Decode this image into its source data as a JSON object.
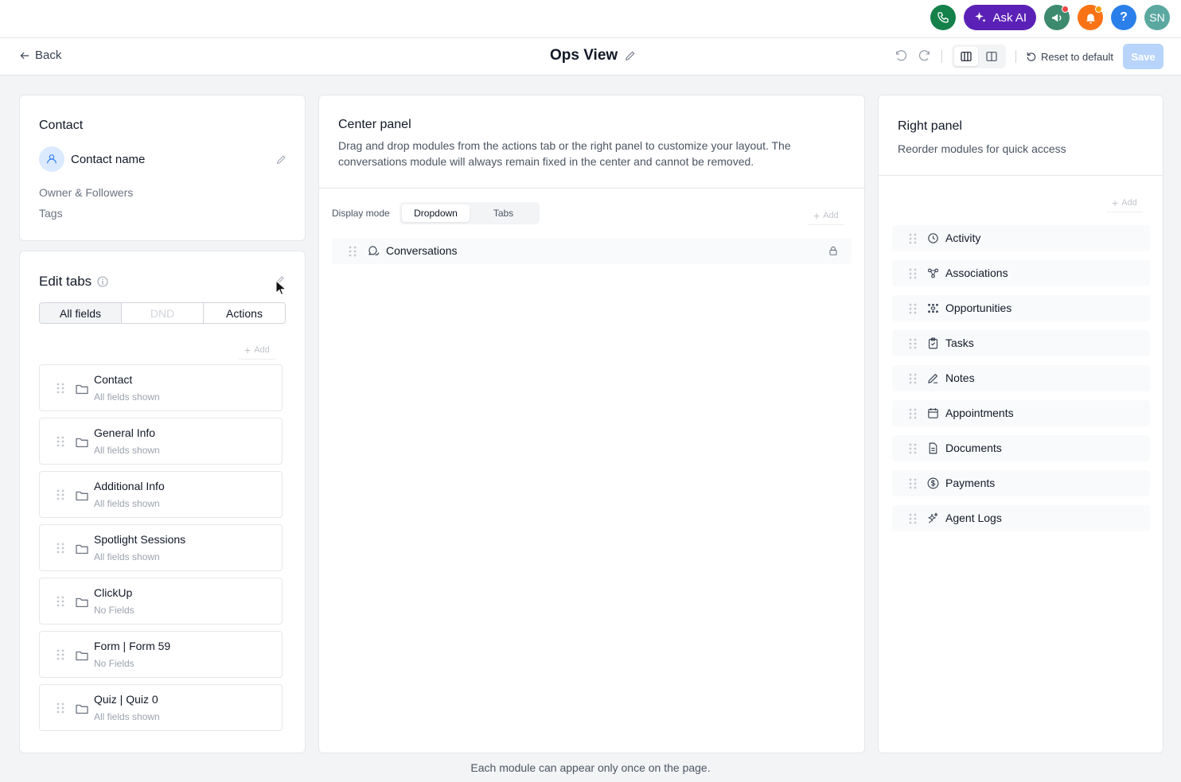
{
  "header": {
    "ask_ai_label": "Ask AI",
    "avatar_initials": "SN",
    "colors": {
      "phone": "#14804a",
      "ask_ai": "#5b21b6",
      "megaphone": "#3d8a6e",
      "bell": "#f97316",
      "help": "#2b7fea",
      "avatar": "#5ba8a0",
      "alert_dot": "#ef4444"
    }
  },
  "subheader": {
    "back_label": "Back",
    "title": "Ops View",
    "reset_label": "Reset to default",
    "save_label": "Save"
  },
  "contact_card": {
    "title": "Contact",
    "contact_name": "Contact name",
    "owner_followers": "Owner & Followers",
    "tags": "Tags"
  },
  "edit_tabs": {
    "title": "Edit tabs",
    "segments": [
      "All fields",
      "DND",
      "Actions"
    ],
    "add_label": "Add",
    "tabs": [
      {
        "name": "Contact",
        "sub": "All fields shown"
      },
      {
        "name": "General Info",
        "sub": "All fields shown"
      },
      {
        "name": "Additional Info",
        "sub": "All fields shown"
      },
      {
        "name": "Spotlight Sessions",
        "sub": "All fields shown"
      },
      {
        "name": "ClickUp",
        "sub": "No Fields"
      },
      {
        "name": "Form | Form 59",
        "sub": "No Fields"
      },
      {
        "name": "Quiz | Quiz 0",
        "sub": "All fields shown"
      }
    ]
  },
  "center_panel": {
    "title": "Center panel",
    "description": "Drag and drop modules from the actions tab or the right panel to customize your layout. The conversations module will always remain fixed in the center and cannot be removed.",
    "display_mode_label": "Display mode",
    "display_options": [
      "Dropdown",
      "Tabs"
    ],
    "selected_display": "Dropdown",
    "add_label": "Add",
    "fixed_module": "Conversations"
  },
  "right_panel": {
    "title": "Right panel",
    "subtitle": "Reorder modules for quick access",
    "add_label": "Add",
    "modules": [
      {
        "name": "Activity",
        "icon": "clock-icon"
      },
      {
        "name": "Associations",
        "icon": "associations-icon"
      },
      {
        "name": "Opportunities",
        "icon": "opportunities-icon"
      },
      {
        "name": "Tasks",
        "icon": "clipboard-check-icon"
      },
      {
        "name": "Notes",
        "icon": "pencil-icon"
      },
      {
        "name": "Appointments",
        "icon": "calendar-icon"
      },
      {
        "name": "Documents",
        "icon": "document-icon"
      },
      {
        "name": "Payments",
        "icon": "dollar-circle-icon"
      },
      {
        "name": "Agent Logs",
        "icon": "sparkle-icon"
      }
    ]
  },
  "footer_note": "Each module can appear only once on the page."
}
